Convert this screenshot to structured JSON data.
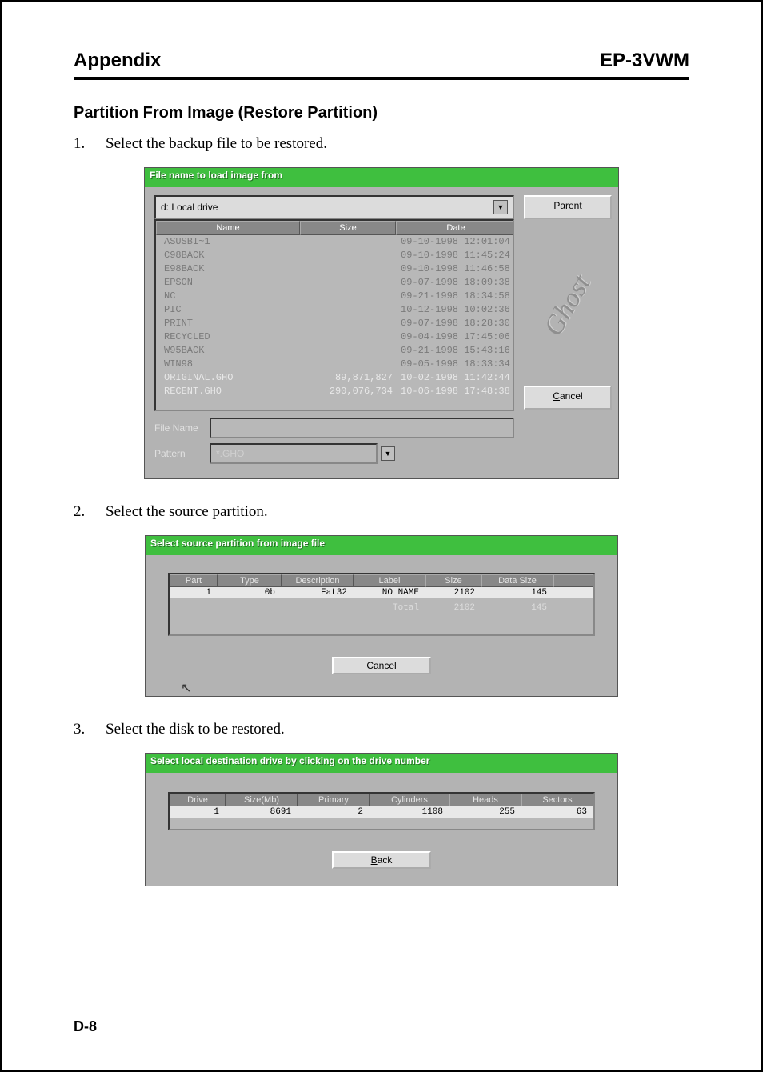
{
  "header": {
    "left": "Appendix",
    "right": "EP-3VWM"
  },
  "section_title": "Partition From Image (Restore Partition)",
  "step1": {
    "num": "1.",
    "text": "Select the backup file to be restored."
  },
  "step2": {
    "num": "2.",
    "text": "Select the source partition."
  },
  "step3": {
    "num": "3.",
    "text": "Select the disk to be restored."
  },
  "page_num": "D-8",
  "dlg1": {
    "title": "File name to load image from",
    "drive": "d: Local drive",
    "cols": {
      "name": "Name",
      "size": "Size",
      "date": "Date"
    },
    "rows": [
      {
        "name": "ASUSBI~1",
        "size": "",
        "date": "09-10-1998 12:01:04",
        "dim": true
      },
      {
        "name": "C98BACK",
        "size": "",
        "date": "09-10-1998 11:45:24",
        "dim": true
      },
      {
        "name": "E98BACK",
        "size": "",
        "date": "09-10-1998 11:46:58",
        "dim": true
      },
      {
        "name": "EPSON",
        "size": "",
        "date": "09-07-1998 18:09:38",
        "dim": true
      },
      {
        "name": "NC",
        "size": "",
        "date": "09-21-1998 18:34:58",
        "dim": true
      },
      {
        "name": "PIC",
        "size": "",
        "date": "10-12-1998 10:02:36",
        "dim": true
      },
      {
        "name": "PRINT",
        "size": "",
        "date": "09-07-1998 18:28:30",
        "dim": true
      },
      {
        "name": "RECYCLED",
        "size": "",
        "date": "09-04-1998 17:45:06",
        "dim": true
      },
      {
        "name": "W95BACK",
        "size": "",
        "date": "09-21-1998 15:43:16",
        "dim": true
      },
      {
        "name": "WIN98",
        "size": "",
        "date": "09-05-1998 18:33:34",
        "dim": true
      },
      {
        "name": "ORIGINAL.GHO",
        "size": "89,871,827",
        "date": "10-02-1998 11:42:44",
        "dim": false
      },
      {
        "name": "RECENT.GHO",
        "size": "290,076,734",
        "date": "10-06-1998 17:48:38",
        "dim": false
      }
    ],
    "parent_btn": {
      "pre": "",
      "ul": "P",
      "post": "arent"
    },
    "cancel_btn": {
      "pre": "",
      "ul": "C",
      "post": "ancel"
    },
    "file_name_lbl": "File Name",
    "pattern_lbl": "Pattern",
    "pattern_val": "*.GHO",
    "logo": "Ghost"
  },
  "dlg2": {
    "title": "Select source partition from image file",
    "cols": {
      "part": "Part",
      "type": "Type",
      "desc": "Description",
      "label": "Label",
      "size": "Size",
      "data": "Data Size"
    },
    "row": {
      "part": "1",
      "type": "0b",
      "desc": "Fat32",
      "label": "NO NAME",
      "size": "2102",
      "data": "145"
    },
    "total_lbl": "Total",
    "total_size": "2102",
    "total_data": "145",
    "cancel_btn": {
      "pre": "",
      "ul": "C",
      "post": "ancel"
    }
  },
  "dlg3": {
    "title": "Select local destination drive by clicking on the drive number",
    "cols": {
      "drive": "Drive",
      "size": "Size(Mb)",
      "primary": "Primary",
      "cyl": "Cylinders",
      "heads": "Heads",
      "sectors": "Sectors"
    },
    "row": {
      "drive": "1",
      "size": "8691",
      "primary": "2",
      "cyl": "1108",
      "heads": "255",
      "sectors": "63"
    },
    "back_btn": {
      "pre": "",
      "ul": "B",
      "post": "ack"
    }
  }
}
